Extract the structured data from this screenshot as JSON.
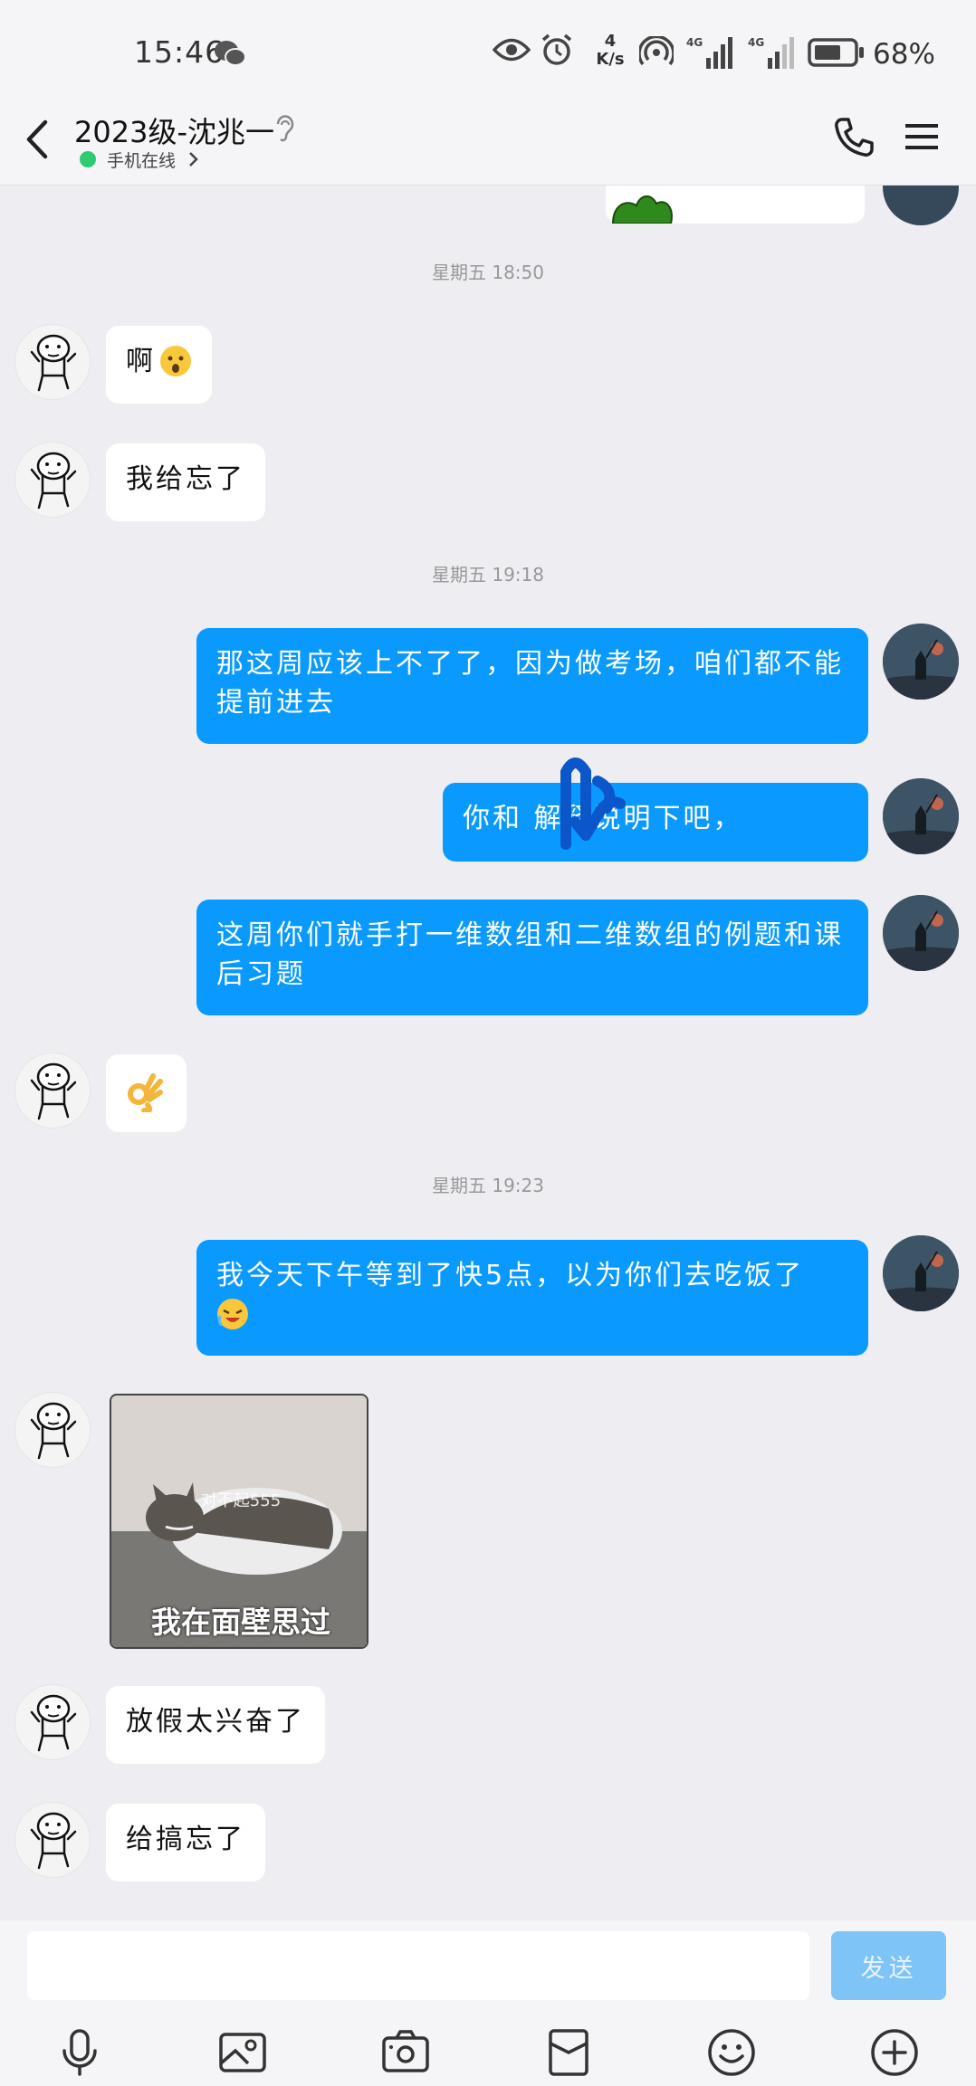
{
  "status_bar": {
    "time": "15:46",
    "net_speed_value": "4",
    "net_speed_unit": "K/s",
    "signal_1": "4G",
    "signal_2": "4G",
    "battery": "68%"
  },
  "header": {
    "title": "2023级-沈兆一",
    "status": "手机在线"
  },
  "messages": {
    "ts1": "星期五 18:50",
    "m1": "啊",
    "m2": "我给忘了",
    "ts2": "星期五 19:18",
    "m3": "那这周应该上不了了，因为做考场，咱们都不能提前进去",
    "m4": "你和           解释说明下吧，",
    "m5": "这周你们就手打一维数组和二维数组的例题和课后习题",
    "ts3": "星期五 19:23",
    "m7": "我今天下午等到了快5点，以为你们去吃饭了",
    "sticker_caption": "我在面壁思过",
    "sticker_sub": "对不起555",
    "m8": "放假太兴奋了",
    "m9": "给搞忘了"
  },
  "input": {
    "placeholder": "",
    "send_label": "发送"
  },
  "colors": {
    "outgoing_bubble": "#0a99ff",
    "incoming_bubble": "#ffffff",
    "send_button": "#7ec4f7",
    "online_dot": "#2ecc71"
  },
  "icons": {
    "toolbar": [
      "microphone-icon",
      "image-icon",
      "camera-icon",
      "red-packet-icon",
      "emoji-icon",
      "plus-icon"
    ]
  }
}
